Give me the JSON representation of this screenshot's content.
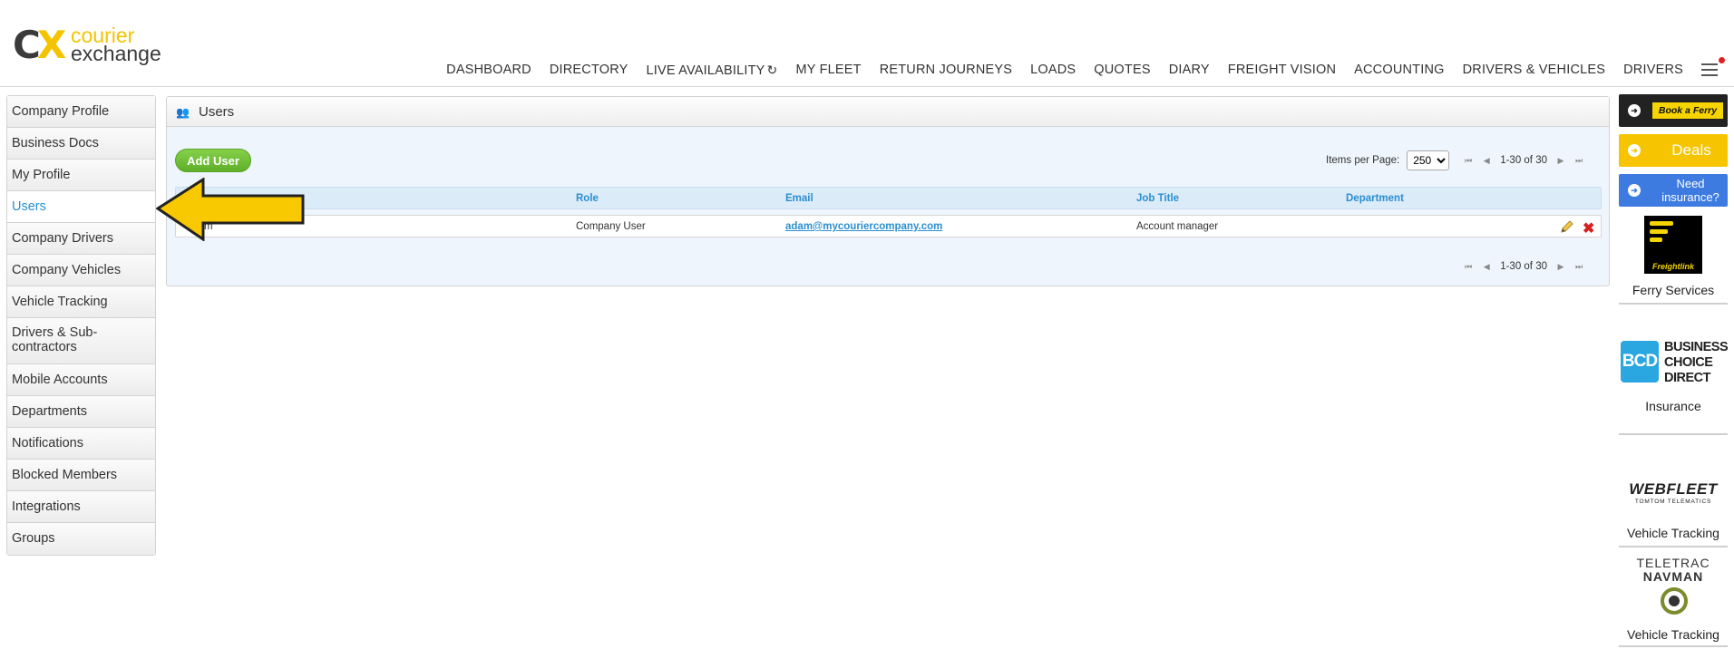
{
  "brand": {
    "mark_c": "C",
    "mark_x": "X",
    "line1": "courier",
    "line2": "exchange"
  },
  "topnav": [
    {
      "label": "DASHBOARD"
    },
    {
      "label": "DIRECTORY"
    },
    {
      "label": "LIVE AVAILABILITY"
    },
    {
      "label": "MY FLEET"
    },
    {
      "label": "RETURN JOURNEYS"
    },
    {
      "label": "LOADS"
    },
    {
      "label": "QUOTES"
    },
    {
      "label": "DIARY"
    },
    {
      "label": "FREIGHT VISION"
    },
    {
      "label": "ACCOUNTING"
    },
    {
      "label": "DRIVERS & VEHICLES"
    },
    {
      "label": "DRIVERS"
    }
  ],
  "sidebar": {
    "items": [
      {
        "label": "Company Profile"
      },
      {
        "label": "Business Docs"
      },
      {
        "label": "My Profile"
      },
      {
        "label": "Users"
      },
      {
        "label": "Company Drivers"
      },
      {
        "label": "Company Vehicles"
      },
      {
        "label": "Vehicle Tracking"
      },
      {
        "label": "Drivers & Sub-contractors"
      },
      {
        "label": "Mobile Accounts"
      },
      {
        "label": "Departments"
      },
      {
        "label": "Notifications"
      },
      {
        "label": "Blocked Members"
      },
      {
        "label": "Integrations"
      },
      {
        "label": "Groups"
      }
    ],
    "active": "Users"
  },
  "panel": {
    "title": "Users",
    "add_button": "Add User",
    "pager": {
      "items_per_page_label": "Items per Page:",
      "items_per_page_value": "250",
      "range": "1-30 of 30"
    },
    "columns": [
      "Role",
      "Email",
      "Job Title",
      "Department"
    ],
    "rows": [
      {
        "name": "m",
        "role": "Company User",
        "email": "adam@mycouriercompany.com",
        "job_title": "Account manager",
        "department": ""
      }
    ]
  },
  "ads": {
    "ferry": "Book a Ferry",
    "deals": "Deals",
    "insurance_line1": "Need",
    "insurance_line2": "insurance?",
    "freightlink_logo": "Freightlink",
    "freightlink_caption": "Ferry Services",
    "bcd_mark": "BCD",
    "bcd_line1": "BUSINESS",
    "bcd_line2": "CHOICE",
    "bcd_line3": "DIRECT",
    "bcd_caption": "Insurance",
    "webfleet_logo": "WEBFLEET",
    "webfleet_sub": "TOMTOM TELEMATICS",
    "webfleet_caption": "Vehicle Tracking",
    "teletrac_line1": "TELETRAC",
    "teletrac_line2": "NAVMAN",
    "teletrac_caption": "Vehicle Tracking"
  },
  "colors": {
    "accent": "#2a8fd0",
    "brand_yellow": "#f5c400",
    "add_green": "#6bbf33",
    "delete_red": "#d62020"
  }
}
